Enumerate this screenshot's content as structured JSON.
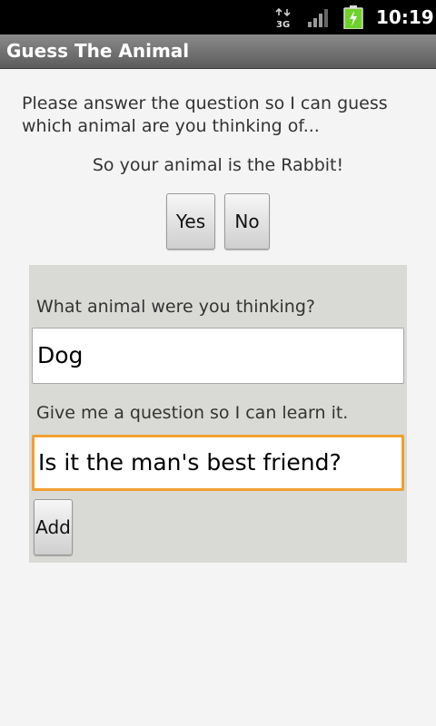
{
  "status_bar": {
    "network": "3G",
    "time": "10:19"
  },
  "app": {
    "title": "Guess The Animal"
  },
  "main": {
    "intro": "Please answer the question so I can guess which animal are you thinking of...",
    "result": "So your animal is the Rabbit!",
    "yes_label": "Yes",
    "no_label": "No"
  },
  "learn_panel": {
    "animal_label": "What animal were you thinking?",
    "animal_value": "Dog",
    "question_label": "Give me a question so I can learn it.",
    "question_value": "Is it the man's best friend?",
    "add_label": "Add"
  },
  "colors": {
    "focus_border": "#f0a030",
    "panel_background": "#d9dad5",
    "battery_green": "#6fd22a"
  },
  "icons": [
    "network-3g-icon",
    "signal-icon",
    "battery-charging-icon"
  ]
}
